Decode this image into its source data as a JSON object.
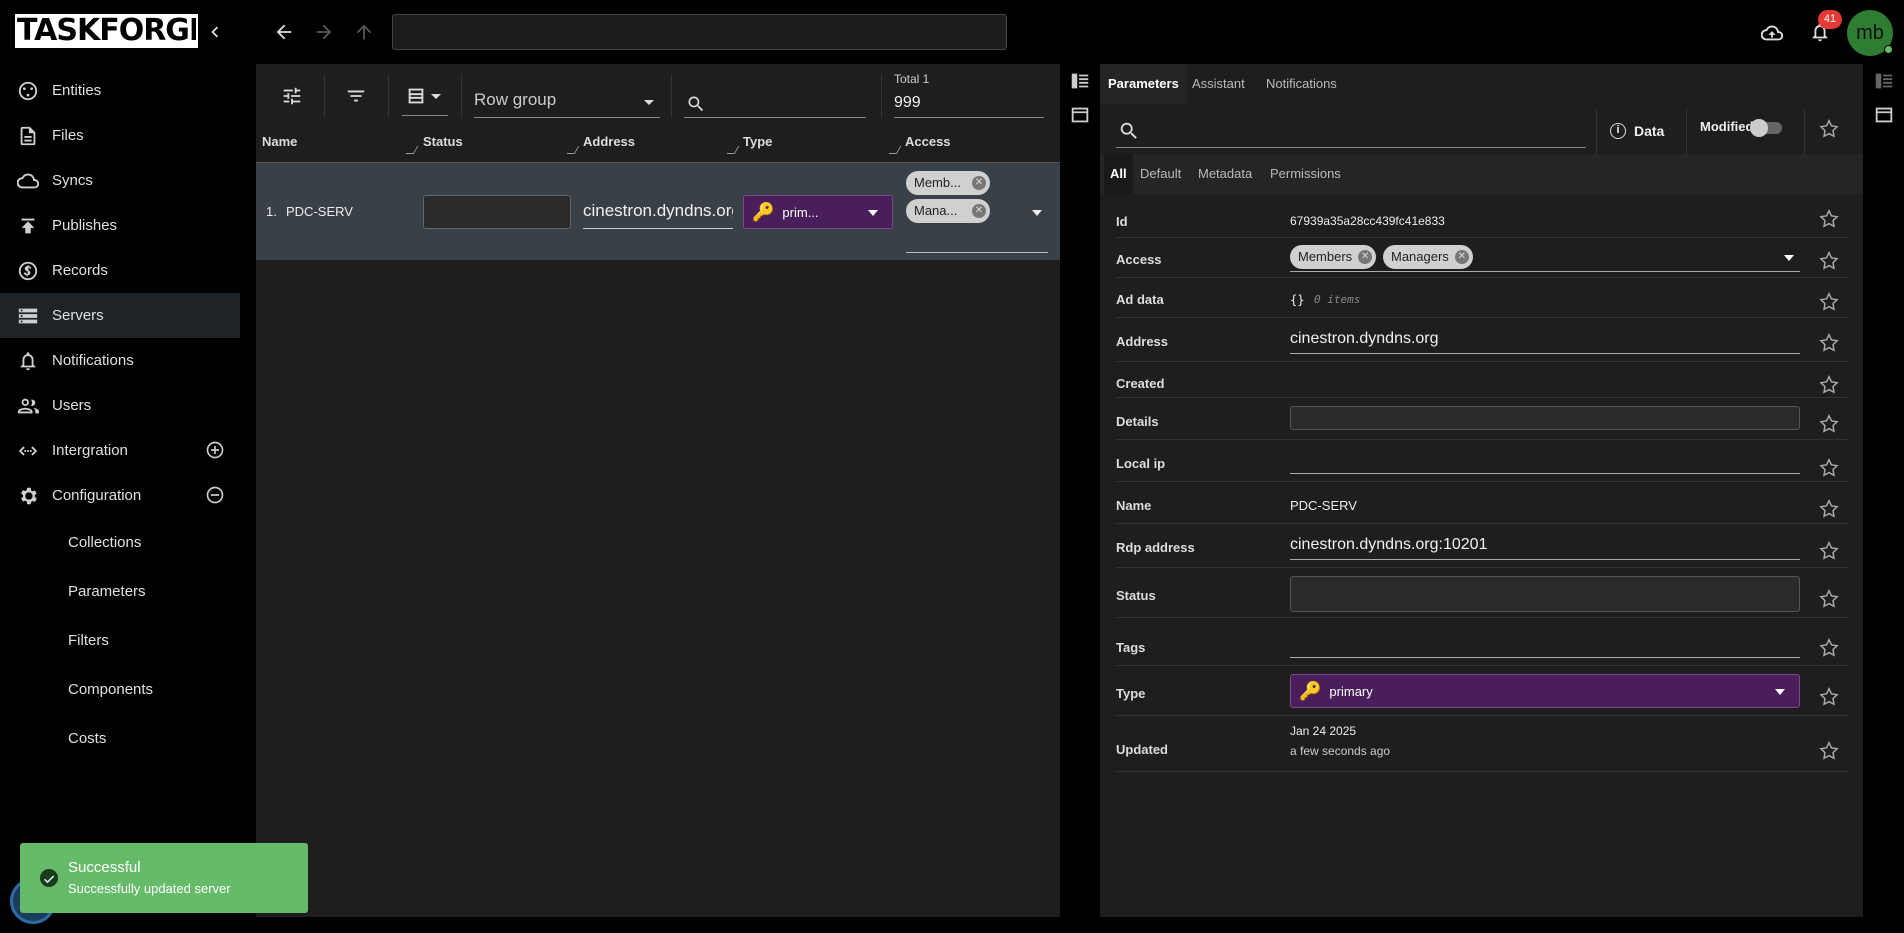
{
  "app": {
    "logo": "TASKFORGER",
    "notification_count": "41",
    "avatar_initials": "mb"
  },
  "sidebar": {
    "items": [
      {
        "label": "Entities",
        "icon": "entities-icon"
      },
      {
        "label": "Files",
        "icon": "file-icon"
      },
      {
        "label": "Syncs",
        "icon": "cloud-sync-icon"
      },
      {
        "label": "Publishes",
        "icon": "publish-icon"
      },
      {
        "label": "Records",
        "icon": "dollar-icon"
      },
      {
        "label": "Servers",
        "icon": "server-icon",
        "active": true
      },
      {
        "label": "Notifications",
        "icon": "bell-icon"
      },
      {
        "label": "Users",
        "icon": "users-icon"
      },
      {
        "label": "Intergration",
        "icon": "integration-icon"
      },
      {
        "label": "Configuration",
        "icon": "gear-icon"
      }
    ],
    "sub_items": [
      "Collections",
      "Parameters",
      "Filters",
      "Components",
      "Costs"
    ]
  },
  "table": {
    "row_group_placeholder": "Row group",
    "total_label": "Total 1",
    "total_value": "999",
    "columns": [
      "Name",
      "Status",
      "Address",
      "Type",
      "Access"
    ],
    "rows": [
      {
        "num": "1.",
        "name": "PDC-SERV",
        "status": "",
        "address": "cinestron.dyndns.org",
        "type": "prim...",
        "access": [
          "Memb...",
          "Mana..."
        ]
      }
    ]
  },
  "detail": {
    "tabs": [
      "Parameters",
      "Assistant",
      "Notifications"
    ],
    "data_button": "Data",
    "modified_label": "Modified",
    "subtabs": [
      "All",
      "Default",
      "Metadata",
      "Permissions"
    ],
    "fields": {
      "id": {
        "label": "Id",
        "value": "67939a35a28cc439fc41e833"
      },
      "access": {
        "label": "Access",
        "chips": [
          "Members",
          "Managers"
        ]
      },
      "ad_data": {
        "label": "Ad data",
        "braces": "{}",
        "count": "0 items"
      },
      "address": {
        "label": "Address",
        "value": "cinestron.dyndns.org"
      },
      "created": {
        "label": "Created",
        "value": ""
      },
      "details": {
        "label": "Details",
        "value": ""
      },
      "local_ip": {
        "label": "Local ip",
        "value": ""
      },
      "name": {
        "label": "Name",
        "value": "PDC-SERV"
      },
      "rdp_address": {
        "label": "Rdp address",
        "value": "cinestron.dyndns.org:10201"
      },
      "status": {
        "label": "Status",
        "value": ""
      },
      "tags": {
        "label": "Tags",
        "value": ""
      },
      "type": {
        "label": "Type",
        "value": "primary"
      },
      "updated": {
        "label": "Updated",
        "value": "Jan 24 2025",
        "relative": "a few seconds ago"
      }
    }
  },
  "toast": {
    "title": "Successful",
    "message": "Successfully updated server"
  },
  "colors": {
    "accent_purple": "#4a1e5a",
    "success_green": "#66bb6a",
    "badge_red": "#e53935",
    "avatar_green": "#2e7d32"
  }
}
